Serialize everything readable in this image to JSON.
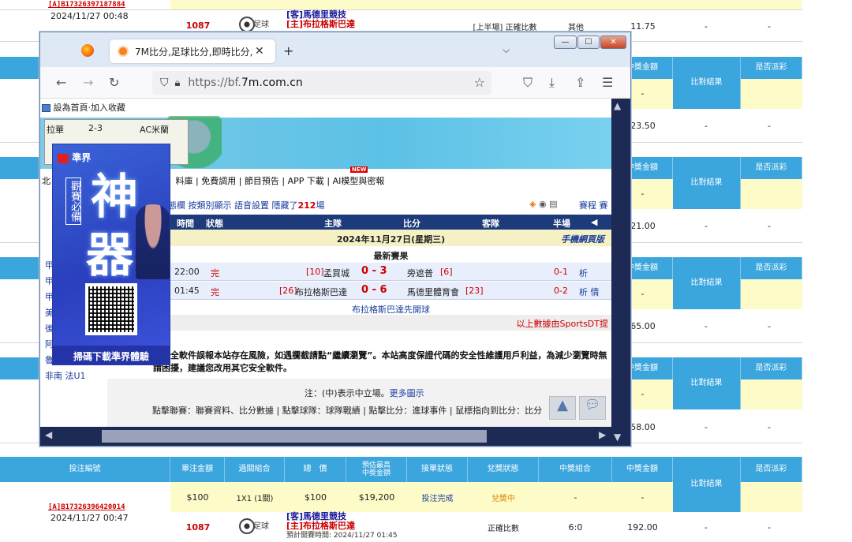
{
  "background_page": {
    "top_bet": {
      "id_prefix": "[A]",
      "id": "B17326397187884",
      "time": "2024/11/27 00:48",
      "match_code": "1087",
      "sport_label": "足球",
      "away": "[客]馬德里競技",
      "home": "[主]布拉格斯巴達",
      "market": "[上半場] 正確比數",
      "selection": "其他",
      "amount": "11.75",
      "c1": "-",
      "c2": "-"
    },
    "right_panels": [
      {
        "header_prize": "中獎金額",
        "header_result": "比對結果",
        "header_paid": "是否派彩",
        "yellow_val": "-",
        "amount": "23.50",
        "c1": "-",
        "c2": "-"
      },
      {
        "header_prize": "中獎金額",
        "header_result": "比對結果",
        "header_paid": "是否派彩",
        "yellow_val": "-",
        "amount": "21.00",
        "c1": "-",
        "c2": "-"
      },
      {
        "header_prize": "中獎金額",
        "header_result": "比對結果",
        "header_paid": "是否派彩",
        "yellow_val": "-",
        "amount": "65.00",
        "c1": "-",
        "c2": "-"
      },
      {
        "header_prize": "中獎金額",
        "header_result": "比對結果",
        "header_paid": "是否派彩",
        "yellow_val": "-",
        "amount": "58.00",
        "c1": "-",
        "c2": "-"
      }
    ],
    "bottom_table": {
      "headers": [
        "投注編號",
        "單注金額",
        "過關組合",
        "總　價",
        "預估最高\n中獎金額",
        "接單狀態",
        "兌獎狀態",
        "中獎組合",
        "中獎金額",
        "比對結果",
        "是否派彩"
      ],
      "summary": {
        "unit_amount": "$100",
        "combo": "1X1 (1關)",
        "total": "$100",
        "max_prize": "$19,200",
        "order_status": "投注完成",
        "redeem_status": "兌獎中",
        "win_combo": "-",
        "win_amount": "-"
      },
      "bet": {
        "id_prefix": "[A]",
        "id": "B17326396420014",
        "time": "2024/11/27 00:47",
        "match_code": "1087",
        "sport_label": "足球",
        "away": "[客]馬德里競技",
        "home": "[主]布拉格斯巴達",
        "kickoff": "預計開賽時間: 2024/11/27 01:45",
        "market": "正確比數",
        "selection": "6:0",
        "amount": "192.00",
        "c1": "-",
        "c2": "-"
      }
    }
  },
  "browser": {
    "tab_title": "7M比分,足球比分,即時比分,比分",
    "url_prefix": "https://bf.",
    "url_host": "7m.com.cn",
    "new_tab": "+",
    "icons": [
      "firefox-icon",
      "tab-favicon",
      "back-icon",
      "forward-icon",
      "reload-icon",
      "shield-icon",
      "lock-icon",
      "bookmark-star-icon",
      "pocket-icon",
      "download-icon",
      "share-icon",
      "menu-icon"
    ]
  },
  "site": {
    "fav_text": "設為首頁‧加入收藏",
    "mini_score": {
      "home": "拉華",
      "score": "2-3",
      "away": "AC米蘭"
    },
    "menu": "料庫 | 免費調用 | 節目預告 | APP 下載 | AI模型與密報",
    "new_badge": "NEW",
    "menu_left": "北",
    "submenu": {
      "text": "態欄 按類別顯示 語音設置 隱藏了",
      "count": "212",
      "suffix": "場",
      "right": "賽程",
      "right2": "賽"
    },
    "schedule_headers": [
      "時間",
      "狀態",
      "主隊",
      "比分",
      "客隊",
      "半場"
    ],
    "promo_app": "手機網頁版",
    "date_row": "2024年11月27日(星期三)",
    "latest_row": "最新賽果",
    "matches": [
      {
        "time": "22:00",
        "status": "完",
        "home_rank": "[10]",
        "home": "孟買城",
        "score": "0 - 3",
        "away": "旁遮普",
        "away_rank": "[6]",
        "half": "0-1",
        "analysis": "析"
      },
      {
        "time": "01:45",
        "status": "完",
        "home_rank": "[26]",
        "home": "布拉格斯巴達",
        "score": "0 - 6",
        "away": "馬德里體育會",
        "away_rank": "[23]",
        "half": "0-2",
        "analysis": "析 情"
      }
    ],
    "first_goal": "布拉格斯巴達先開球",
    "data_from": "以上數據由SportsDT提",
    "side_links": [
      "甲",
      "甲",
      "甲",
      "美",
      "後",
      "阿",
      "魯甲 葡U2",
      "非南 法U1"
    ],
    "warning": "禁安全軟件誤報本站存在風險，如遇攔截請點“繼續瀏覽”。本站高度保證代碼的安全性維護用戶利益，為減少瀏覽時無謂困擾，建議您改用其它安全軟件。",
    "note": "注：(中)表示中立場。",
    "note_link": "更多圖示",
    "help_line": "點擊聯賽：聯賽資料、比分數據 | 點擊球隊：球隊戰績 | 點擊比分：進球事件 | 鼠標指向到比分：比分"
  },
  "promo": {
    "brand": "準界",
    "vertical": "觀賽必備",
    "big1": "神",
    "big2": "器",
    "footer": "掃碼下載準界體驗"
  }
}
